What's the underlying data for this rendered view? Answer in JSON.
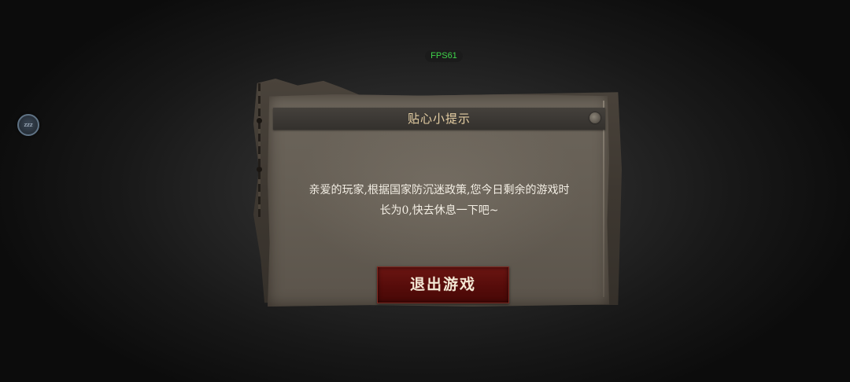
{
  "hud": {
    "fps_label": "FPS61"
  },
  "float_button": {
    "label": "zzz",
    "icon": "sleep-icon"
  },
  "dialog": {
    "title": "贴心小提示",
    "message_lines": [
      "亲爱的玩家,根据国家防沉迷政策,您今日剩余的游戏时",
      "长为0,快去休息一下吧~"
    ],
    "exit_button_label": "退出游戏"
  },
  "colors": {
    "fps_text": "#3fd44a",
    "title_text": "#e6cfa4",
    "message_text": "#f2ede3",
    "button_bg": "#560c0a",
    "paper": "#655e54"
  }
}
